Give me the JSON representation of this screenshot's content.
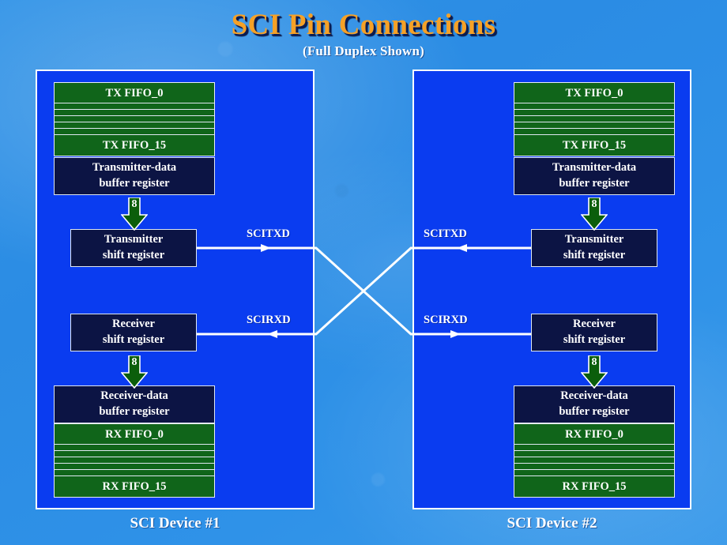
{
  "title": {
    "main": "SCI Pin Connections",
    "subtitle": "(Full Duplex Shown)"
  },
  "colors": {
    "background_blue": "#2f92e6",
    "panel_blue": "#0A3CF0",
    "fifo_green": "#10651a",
    "register_navy": "#0C1444",
    "title_orange": "#F5A127",
    "title_shadow": "#0c1c52",
    "line_white": "#ffffff"
  },
  "devices": [
    {
      "caption": "SCI Device #1",
      "tx_fifo": {
        "first": "TX FIFO_0",
        "last": "TX FIFO_15",
        "hidden_bar_count": 5
      },
      "tx_buffer_register": {
        "line1": "Transmitter-data",
        "line2": "buffer register"
      },
      "tx_bus": {
        "width_label": "8"
      },
      "transmitter_shift_register": {
        "line1": "Transmitter",
        "line2": "shift register"
      },
      "receiver_shift_register": {
        "line1": "Receiver",
        "line2": "shift register"
      },
      "rx_bus": {
        "width_label": "8"
      },
      "rx_buffer_register": {
        "line1": "Receiver-data",
        "line2": "buffer register"
      },
      "rx_fifo": {
        "first": "RX FIFO_0",
        "last": "RX FIFO_15",
        "hidden_bar_count": 5
      }
    },
    {
      "caption": "SCI Device #2",
      "tx_fifo": {
        "first": "TX FIFO_0",
        "last": "TX FIFO_15",
        "hidden_bar_count": 5
      },
      "tx_buffer_register": {
        "line1": "Transmitter-data",
        "line2": "buffer register"
      },
      "tx_bus": {
        "width_label": "8"
      },
      "transmitter_shift_register": {
        "line1": "Transmitter",
        "line2": "shift register"
      },
      "receiver_shift_register": {
        "line1": "Receiver",
        "line2": "shift register"
      },
      "rx_bus": {
        "width_label": "8"
      },
      "rx_buffer_register": {
        "line1": "Receiver-data",
        "line2": "buffer register"
      },
      "rx_fifo": {
        "first": "RX FIFO_0",
        "last": "RX FIFO_15",
        "hidden_bar_count": 5
      }
    }
  ],
  "signals": {
    "left_tx": "SCITXD",
    "left_rx": "SCIRXD",
    "right_tx": "SCITXD",
    "right_rx": "SCIRXD"
  }
}
